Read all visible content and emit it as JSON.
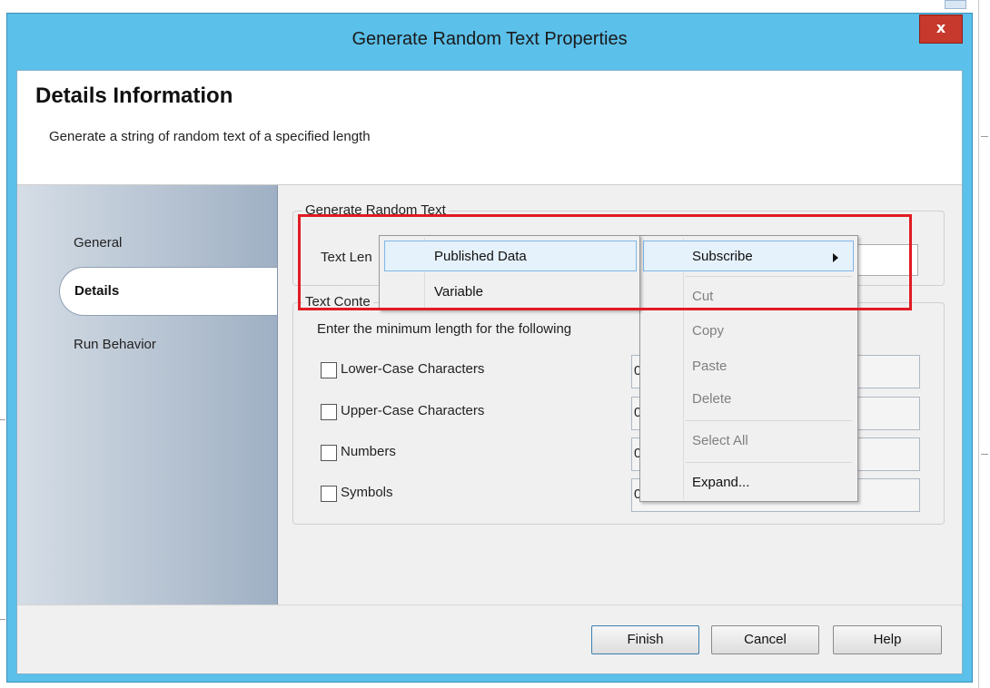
{
  "window": {
    "title": "Generate Random Text Properties",
    "close_label": "x"
  },
  "header": {
    "title": "Details Information",
    "subtitle": "Generate a string of random text of a specified length"
  },
  "sidebar": {
    "items": [
      {
        "label": "General",
        "selected": false
      },
      {
        "label": "Details",
        "selected": true
      },
      {
        "label": "Run Behavior",
        "selected": false
      }
    ]
  },
  "generate_group": {
    "legend": "Generate Random Text",
    "text_length_label": "Text Len",
    "text_length_value": ""
  },
  "content_group": {
    "legend": "Text Conte",
    "instruction": "Enter the minimum length for the following",
    "options": [
      {
        "label": "Lower-Case Characters",
        "checked": false,
        "value": "0"
      },
      {
        "label": "Upper-Case Characters",
        "checked": false,
        "value": "0"
      },
      {
        "label": "Numbers",
        "checked": false,
        "value": "0"
      },
      {
        "label": "Symbols",
        "checked": false,
        "value": "0"
      }
    ]
  },
  "footer": {
    "finish": "Finish",
    "cancel": "Cancel",
    "help": "Help"
  },
  "context_menu": {
    "items": [
      {
        "label": "Subscribe",
        "enabled": true,
        "submenu": true,
        "highlighted": true
      },
      {
        "label": "Cut",
        "enabled": false
      },
      {
        "label": "Copy",
        "enabled": false
      },
      {
        "label": "Paste",
        "enabled": false
      },
      {
        "label": "Delete",
        "enabled": false
      },
      {
        "label": "Select All",
        "enabled": false
      },
      {
        "label": "Expand...",
        "enabled": true
      }
    ]
  },
  "submenu": {
    "items": [
      {
        "label": "Published Data",
        "highlighted": true
      },
      {
        "label": "Variable",
        "highlighted": false
      }
    ]
  },
  "colors": {
    "titlebar": "#5bc0ea",
    "close_button": "#c7382d",
    "highlight_box": "#e21b23",
    "menu_highlight": "#e5f1fb"
  }
}
